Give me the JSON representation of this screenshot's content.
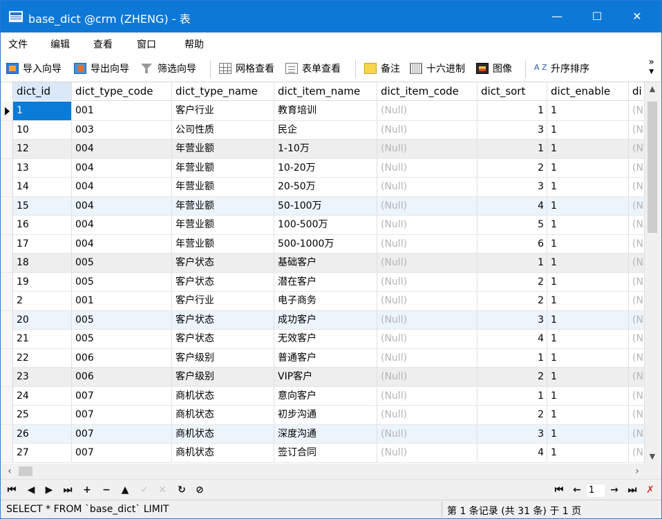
{
  "window": {
    "title": "base_dict @crm (ZHENG) - 表",
    "min_glyph": "—",
    "max_glyph": "☐",
    "close_glyph": "✕"
  },
  "menu": [
    "文件",
    "编辑",
    "查看",
    "窗口",
    "帮助"
  ],
  "toolbar": {
    "import_wizard": "导入向导",
    "export_wizard": "导出向导",
    "filter_wizard": "筛选向导",
    "grid_view": "网格查看",
    "form_view": "表单查看",
    "memo": "备注",
    "hex": "十六进制",
    "image": "图像",
    "sort_asc_icon_text": "A Z",
    "sort_asc": "升序排序",
    "more": "»"
  },
  "grid": {
    "columns": [
      "dict_id",
      "dict_type_code",
      "dict_type_name",
      "dict_item_name",
      "dict_item_code",
      "dict_sort",
      "dict_enable",
      "di"
    ],
    "null_text": "(Null)",
    "null_short": "(N",
    "rows": [
      [
        "1",
        "001",
        "客户行业",
        "教育培训",
        "(Null)",
        "1",
        "1",
        "(N"
      ],
      [
        "10",
        "003",
        "公司性质",
        "民企",
        "(Null)",
        "3",
        "1",
        "(N"
      ],
      [
        "12",
        "004",
        "年营业额",
        "1-10万",
        "(Null)",
        "1",
        "1",
        "(N"
      ],
      [
        "13",
        "004",
        "年营业额",
        "10-20万",
        "(Null)",
        "2",
        "1",
        "(N"
      ],
      [
        "14",
        "004",
        "年营业额",
        "20-50万",
        "(Null)",
        "3",
        "1",
        "(N"
      ],
      [
        "15",
        "004",
        "年营业额",
        "50-100万",
        "(Null)",
        "4",
        "1",
        "(N"
      ],
      [
        "16",
        "004",
        "年营业额",
        "100-500万",
        "(Null)",
        "5",
        "1",
        "(N"
      ],
      [
        "17",
        "004",
        "年营业额",
        "500-1000万",
        "(Null)",
        "6",
        "1",
        "(N"
      ],
      [
        "18",
        "005",
        "客户状态",
        "基础客户",
        "(Null)",
        "1",
        "1",
        "(N"
      ],
      [
        "19",
        "005",
        "客户状态",
        "潜在客户",
        "(Null)",
        "2",
        "1",
        "(N"
      ],
      [
        "2",
        "001",
        "客户行业",
        "电子商务",
        "(Null)",
        "2",
        "1",
        "(N"
      ],
      [
        "20",
        "005",
        "客户状态",
        "成功客户",
        "(Null)",
        "3",
        "1",
        "(N"
      ],
      [
        "21",
        "005",
        "客户状态",
        "无效客户",
        "(Null)",
        "4",
        "1",
        "(N"
      ],
      [
        "22",
        "006",
        "客户级别",
        "普通客户",
        "(Null)",
        "1",
        "1",
        "(N"
      ],
      [
        "23",
        "006",
        "客户级别",
        "VIP客户",
        "(Null)",
        "2",
        "1",
        "(N"
      ],
      [
        "24",
        "007",
        "商机状态",
        "意向客户",
        "(Null)",
        "1",
        "1",
        "(N"
      ],
      [
        "25",
        "007",
        "商机状态",
        "初步沟通",
        "(Null)",
        "2",
        "1",
        "(N"
      ],
      [
        "26",
        "007",
        "商机状态",
        "深度沟通",
        "(Null)",
        "3",
        "1",
        "(N"
      ],
      [
        "27",
        "007",
        "商机状态",
        "签订合同",
        "(Null)",
        "4",
        "1",
        "(N"
      ]
    ]
  },
  "nav": {
    "first": "⏮",
    "prev": "◀",
    "next": "▶",
    "last": "⏭",
    "add": "+",
    "delete": "−",
    "up": "▲",
    "apply": "✓",
    "cancel": "✕",
    "refresh": "↻",
    "stop": "⊘",
    "page_first": "⏮",
    "page_prev": "←",
    "page_value": "1",
    "page_next": "→",
    "page_last": "⏭",
    "settings": "✗"
  },
  "status": {
    "sql": "SELECT * FROM `base_dict` LIMIT",
    "records": "第 1 条记录 (共 31 条) 于 1 页"
  },
  "colors": {
    "titlebar": "#0e78d7",
    "selected_cell": "#0a7bd6",
    "header_selected": "#dbe8f7",
    "null_text": "#b4b4b4"
  }
}
